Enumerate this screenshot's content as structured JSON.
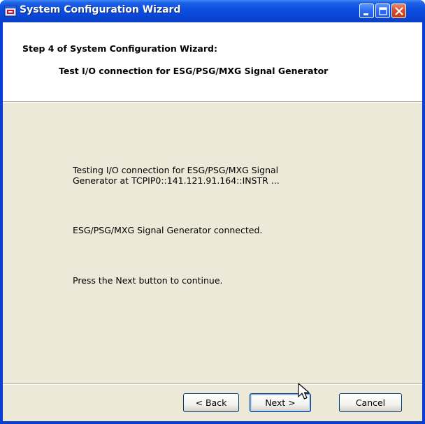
{
  "window": {
    "title": "System Configuration Wizard",
    "icon": "wizard-app-icon",
    "controls": [
      "minimize-icon",
      "maximize-icon",
      "close-icon"
    ]
  },
  "header": {
    "step": "Step 4 of System Configuration Wizard:",
    "subtitle": "Test I/O connection for ESG/PSG/MXG Signal Generator"
  },
  "body": {
    "testing_line1": "Testing I/O connection for ESG/PSG/MXG Signal",
    "testing_line2": "Generator at TCPIP0::141.121.91.164::INSTR ...",
    "connected": "ESG/PSG/MXG Signal Generator connected.",
    "instruction": "Press the Next button to continue."
  },
  "buttons": {
    "back": "< Back",
    "next": "Next >",
    "cancel": "Cancel"
  },
  "colors": {
    "titlebar": "#0a47d8",
    "dialog_background": "#ece9d8",
    "header_background": "#ffffff",
    "close_button": "#d8502a"
  }
}
